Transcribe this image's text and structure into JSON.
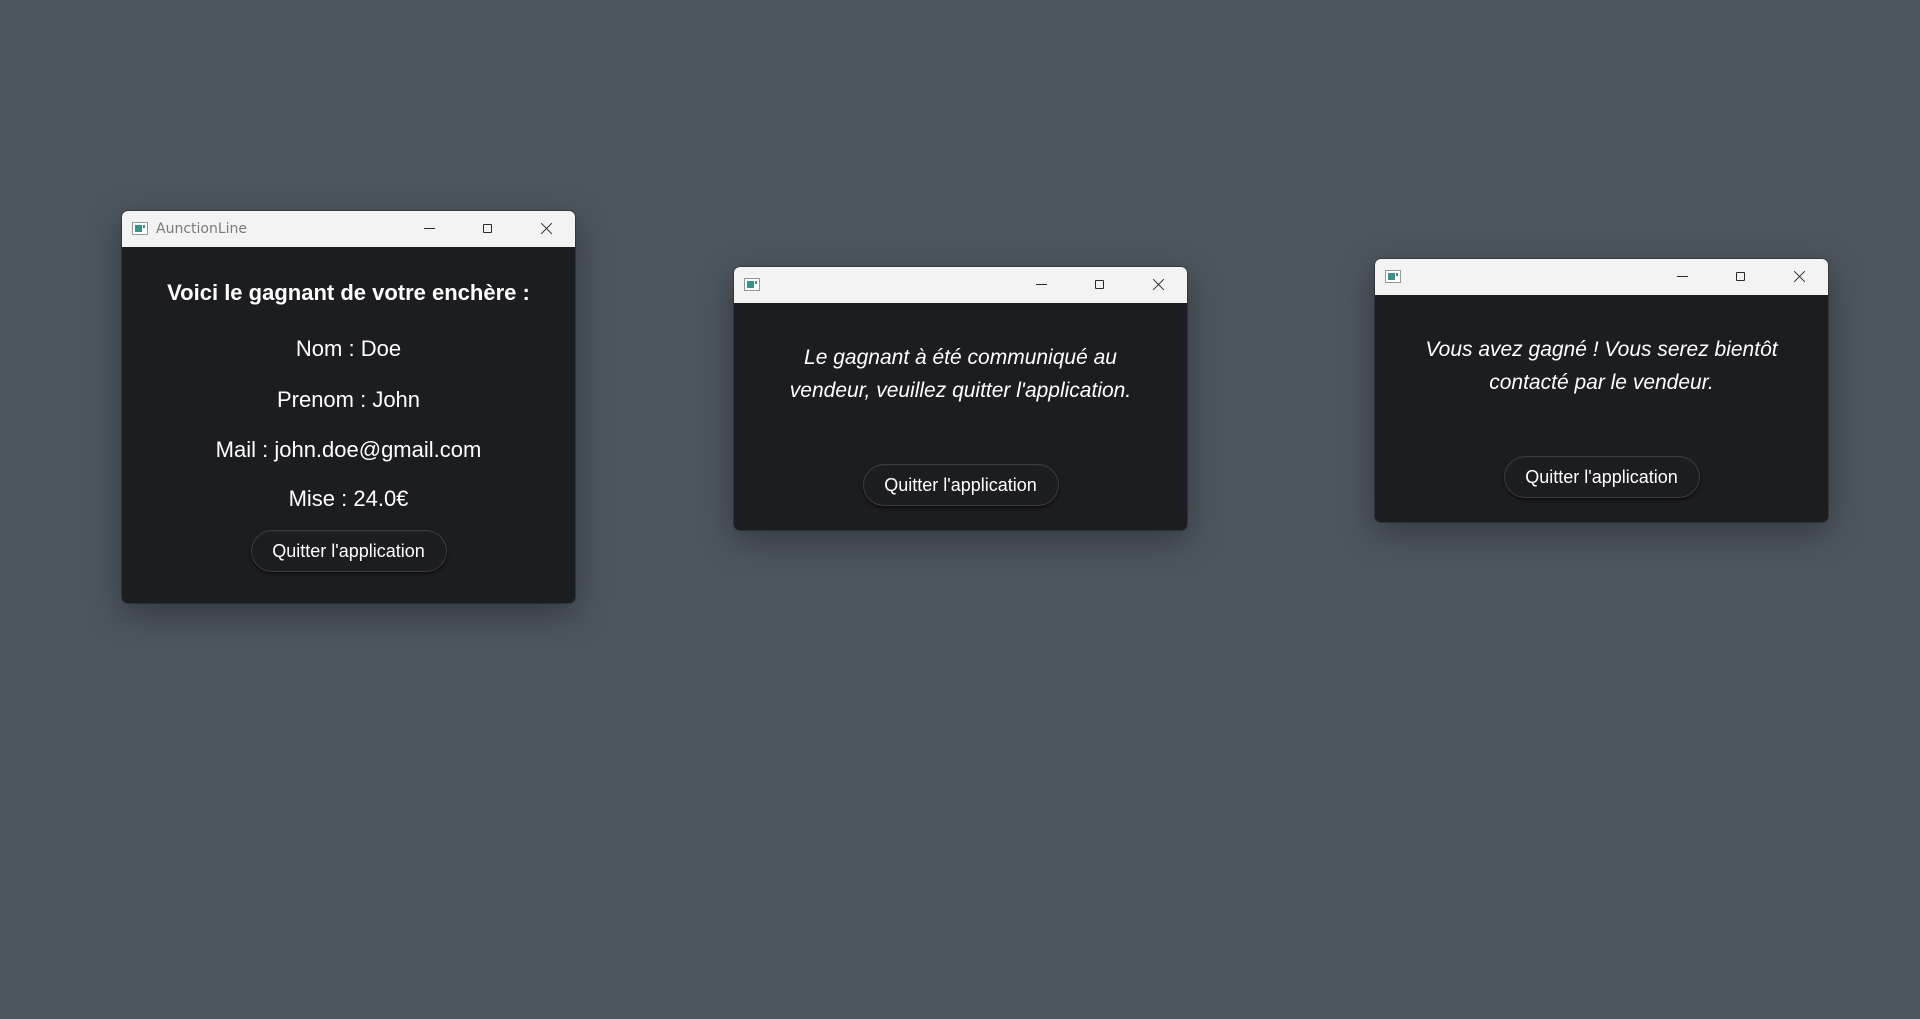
{
  "window1": {
    "title": "AunctionLine",
    "heading": "Voici le gagnant de votre enchère :",
    "nom": "Nom : Doe",
    "prenom": "Prenom : John",
    "mail": "Mail : john.doe@gmail.com",
    "mise": "Mise : 24.0€",
    "quit_label": "Quitter l'application"
  },
  "window2": {
    "title": "",
    "message": "Le gagnant à été communiqué au\nvendeur, veuillez quitter l'application.",
    "quit_label": "Quitter l'application"
  },
  "window3": {
    "title": "",
    "message": "Vous avez gagné ! Vous serez bientôt\ncontacté par le vendeur.",
    "quit_label": "Quitter l'application"
  },
  "icons": {
    "app": "app-window-icon",
    "minimize": "minimize-icon",
    "maximize": "maximize-icon",
    "close": "close-icon"
  }
}
